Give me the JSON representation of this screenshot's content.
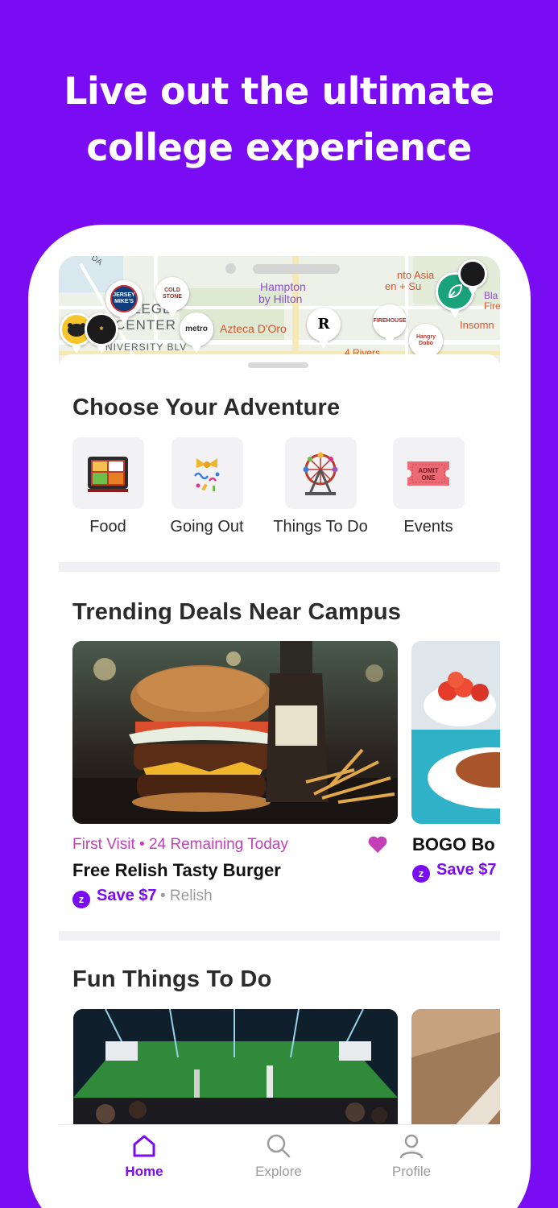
{
  "headline": {
    "line1": "Live out the ultimate",
    "line2": "college experience"
  },
  "map": {
    "labels": {
      "hampton": "Hampton",
      "hilton": "by Hilton",
      "azteca": "Azteca D'Oro",
      "college": "LEGE",
      "center": "CENTER",
      "university": "NIVERSITY BLV",
      "asian": "nto Asia",
      "su": "en + Su",
      "insomnia": "Insomn",
      "bla": "Bla",
      "fire": "Fire",
      "da": "DA",
      "rivers": "4 Rivers"
    },
    "pins": {
      "jersey": "JERSEY MIKE'S",
      "coldstone": "COLD STONE",
      "metro": "metro",
      "rivers": "R",
      "firehouse": "FIREHOUSE",
      "hangry": "Hangry Dobo"
    }
  },
  "adventure": {
    "title": "Choose Your Adventure",
    "categories": [
      {
        "label": "Food",
        "icon": "bento-box-icon"
      },
      {
        "label": "Going Out",
        "icon": "party-popper-icon"
      },
      {
        "label": "Things To Do",
        "icon": "ferris-wheel-icon"
      },
      {
        "label": "Events",
        "icon": "ticket-icon"
      }
    ]
  },
  "trending": {
    "title": "Trending Deals Near Campus",
    "deals": [
      {
        "tag": "First Visit • 24 Remaining Today",
        "title": "Free Relish Tasty Burger",
        "save": "Save $7",
        "vendor": "• Relish"
      },
      {
        "title": "BOGO Bo",
        "save": "Save $7"
      }
    ],
    "ticket_text": "ADMIT ONE"
  },
  "fun": {
    "title": "Fun Things To Do"
  },
  "tabbar": {
    "items": [
      {
        "label": "Home",
        "icon": "home-icon",
        "active": true
      },
      {
        "label": "Explore",
        "icon": "search-icon",
        "active": false
      },
      {
        "label": "Profile",
        "icon": "user-icon",
        "active": false
      }
    ]
  },
  "colors": {
    "brand": "#7a0cf3",
    "deal_tag": "#c23fb5",
    "heart": "#c23fb5"
  }
}
